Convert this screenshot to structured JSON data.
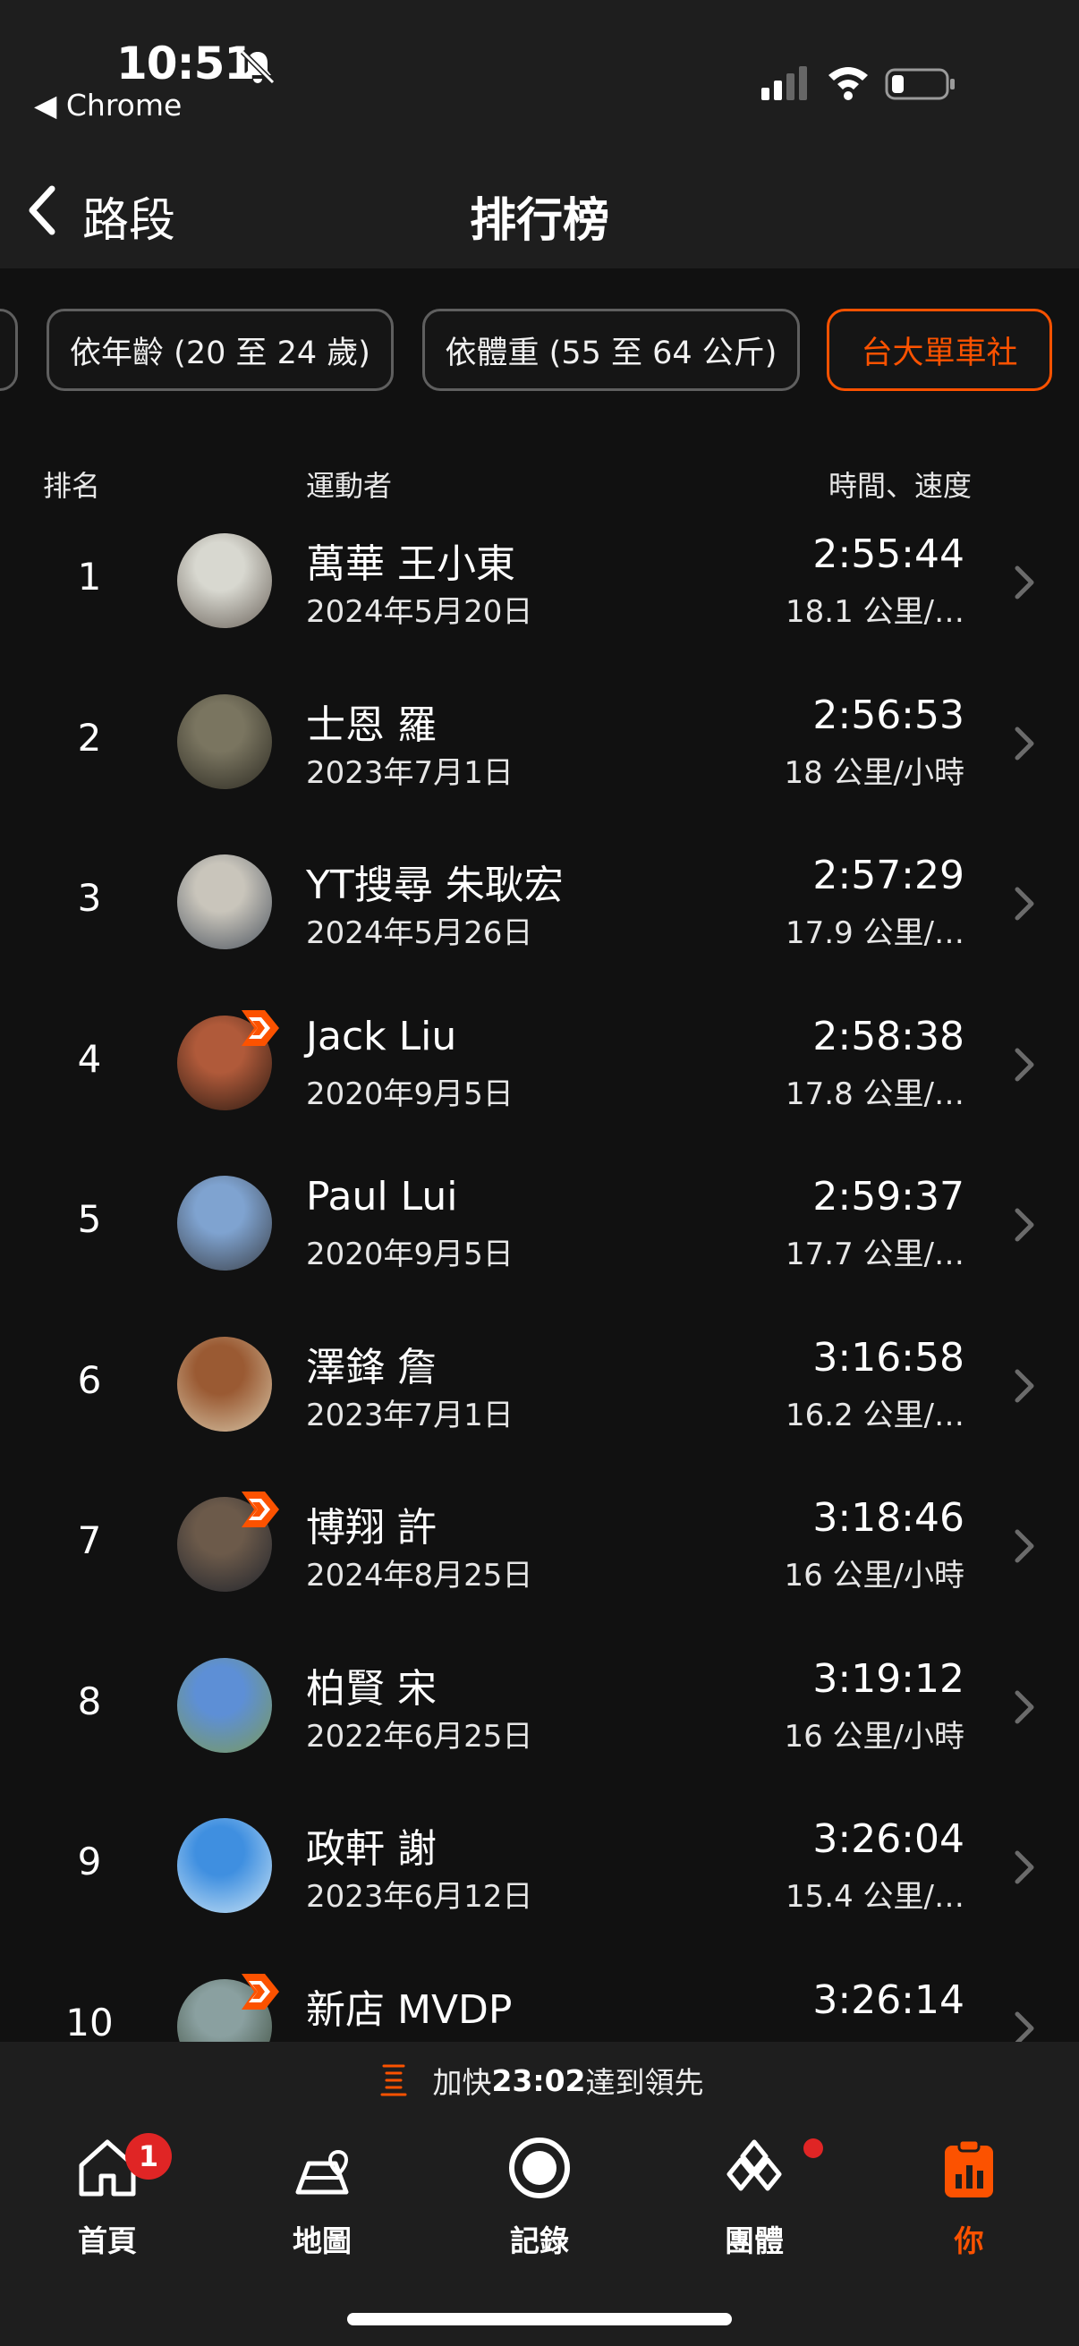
{
  "status_bar": {
    "time": "10:51",
    "back_app": "Chrome",
    "battery_level": 0.2
  },
  "nav": {
    "back_label": "路段",
    "title": "排行榜"
  },
  "filters": [
    "依年齡 (20 至 24 歲)",
    "依體重 (55 至 64 公斤)",
    "台大單車社"
  ],
  "active_filter": "台大單車社",
  "columns": {
    "rank": "排名",
    "athlete": "運動者",
    "time_speed": "時間、速度"
  },
  "leaderboard": [
    {
      "rank": "1",
      "name": "萬華 王小東",
      "date": "2024年5月20日",
      "time": "2:55:44",
      "speed": "18.1 公里/…",
      "badge": false
    },
    {
      "rank": "2",
      "name": "士恩 羅",
      "date": "2023年7月1日",
      "time": "2:56:53",
      "speed": "18 公里/小時",
      "badge": false
    },
    {
      "rank": "3",
      "name": "YT搜尋 朱耿宏",
      "date": "2024年5月26日",
      "time": "2:57:29",
      "speed": "17.9 公里/…",
      "badge": false
    },
    {
      "rank": "4",
      "name": "Jack Liu",
      "date": "2020年9月5日",
      "time": "2:58:38",
      "speed": "17.8 公里/…",
      "badge": true
    },
    {
      "rank": "5",
      "name": "Paul Lui",
      "date": "2020年9月5日",
      "time": "2:59:37",
      "speed": "17.7 公里/…",
      "badge": false
    },
    {
      "rank": "6",
      "name": "澤鋒 詹",
      "date": "2023年7月1日",
      "time": "3:16:58",
      "speed": "16.2 公里/…",
      "badge": false
    },
    {
      "rank": "7",
      "name": "博翔 許",
      "date": "2024年8月25日",
      "time": "3:18:46",
      "speed": "16 公里/小時",
      "badge": true
    },
    {
      "rank": "8",
      "name": "柏賢 宋",
      "date": "2022年6月25日",
      "time": "3:19:12",
      "speed": "16 公里/小時",
      "badge": false
    },
    {
      "rank": "9",
      "name": "政軒 謝",
      "date": "2023年6月12日",
      "time": "3:26:04",
      "speed": "15.4 公里/…",
      "badge": false
    },
    {
      "rank": "10",
      "name": "新店 MVDP",
      "date": "",
      "time": "3:26:14",
      "speed": "",
      "badge": true
    }
  ],
  "banner": {
    "prefix": "加快",
    "gap": "23:02",
    "suffix": "達到領先"
  },
  "tabs": [
    {
      "label": "首頁",
      "icon": "home-icon",
      "badge": "1"
    },
    {
      "label": "地圖",
      "icon": "map-icon"
    },
    {
      "label": "記錄",
      "icon": "record-icon"
    },
    {
      "label": "團體",
      "icon": "groups-icon",
      "dot": true
    },
    {
      "label": "你",
      "icon": "you-icon",
      "active": true
    }
  ],
  "colors": {
    "accent": "#fc5200",
    "background": "#111111",
    "bar": "#1e1e1e",
    "notification": "#e02525"
  }
}
